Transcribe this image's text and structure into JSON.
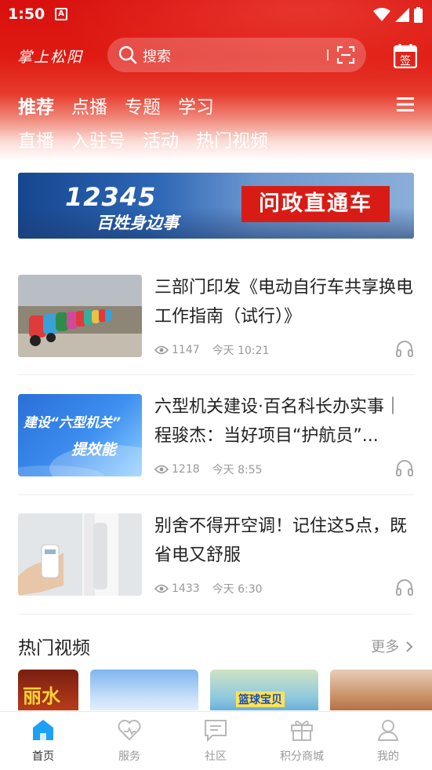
{
  "status": {
    "time": "1:50",
    "app_icon": "A"
  },
  "header": {
    "logo": "掌上松阳",
    "search_placeholder": "搜索",
    "nav_row1": [
      "推荐",
      "点播",
      "专题",
      "学习"
    ],
    "nav_row2": [
      "直播",
      "入驻号",
      "活动",
      "热门视频"
    ],
    "active_tab": "推荐"
  },
  "banner": {
    "number": "12345",
    "subtitle": "百姓身边事",
    "badge": "问政直通车"
  },
  "articles": [
    {
      "title": "三部门印发《电动自行车共享换电工作指南（试行）》",
      "views": "1147",
      "time": "今天 10:21"
    },
    {
      "title": "六型机关建设·百名科长办实事｜程骏杰：当好项目“护航员”...",
      "views": "1218",
      "time": "今天 8:55",
      "thumb_text_line1": "建设“六型机关”",
      "thumb_text_line2": "提效能"
    },
    {
      "title": "别舍不得开空调！记住这5点，既省电又舒服",
      "views": "1433",
      "time": "今天 6:30"
    }
  ],
  "hot_videos": {
    "title": "热门视频",
    "more": "更多",
    "thumb_texts": [
      "丽水",
      "篮球宝贝"
    ]
  },
  "bottom_nav": [
    {
      "label": "首页",
      "icon": "home-icon",
      "active": true
    },
    {
      "label": "服务",
      "icon": "heart-icon",
      "active": false
    },
    {
      "label": "社区",
      "icon": "chat-icon",
      "active": false
    },
    {
      "label": "积分商城",
      "icon": "gift-icon",
      "active": false
    },
    {
      "label": "我的",
      "icon": "user-icon",
      "active": false
    }
  ],
  "colors": {
    "brand_red": "#d8100e",
    "accent_blue": "#1e90ff",
    "text_gray": "#999999"
  }
}
